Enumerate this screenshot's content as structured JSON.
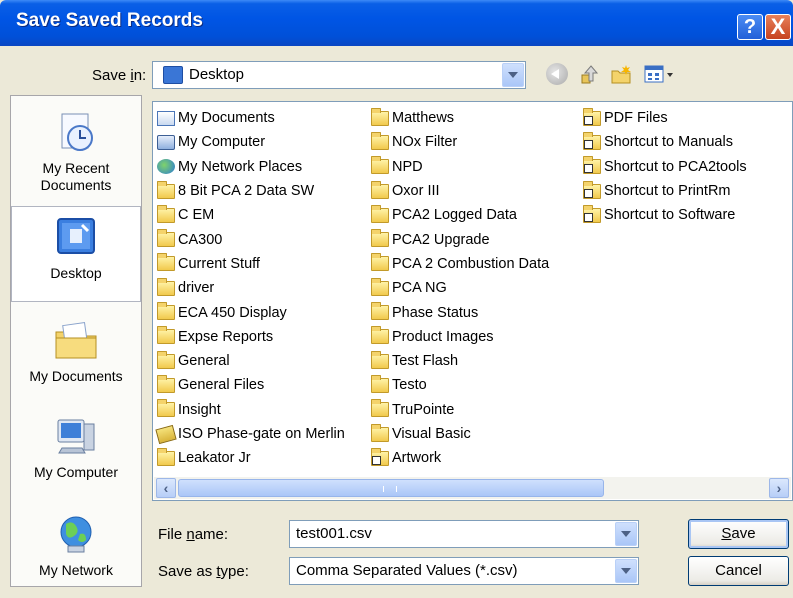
{
  "window": {
    "title": "Save Saved Records"
  },
  "titlebar": {
    "help_glyph": "?",
    "close_glyph": "X"
  },
  "save_in": {
    "label_pre": "Save ",
    "label_accel": "i",
    "label_post": "n:",
    "value": "Desktop"
  },
  "places": [
    {
      "label": "My Recent Documents",
      "icon": "recent-documents-icon"
    },
    {
      "label": "Desktop",
      "icon": "desktop-icon",
      "selected": true
    },
    {
      "label": "My Documents",
      "icon": "my-documents-icon"
    },
    {
      "label": "My Computer",
      "icon": "my-computer-icon"
    },
    {
      "label": "My Network",
      "icon": "my-network-icon"
    }
  ],
  "files": {
    "col1": [
      {
        "name": "My Documents",
        "type": "docs"
      },
      {
        "name": "My Computer",
        "type": "computer"
      },
      {
        "name": "My Network Places",
        "type": "network"
      },
      {
        "name": "8 Bit PCA 2 Data SW",
        "type": "folder"
      },
      {
        "name": "C EM",
        "type": "folder"
      },
      {
        "name": "CA300",
        "type": "folder"
      },
      {
        "name": "Current Stuff",
        "type": "folder"
      },
      {
        "name": "driver",
        "type": "folder"
      },
      {
        "name": "ECA 450 Display",
        "type": "folder"
      },
      {
        "name": "Expse Reports",
        "type": "folder"
      },
      {
        "name": "General",
        "type": "folder"
      },
      {
        "name": "General Files",
        "type": "folder"
      },
      {
        "name": "Insight",
        "type": "folder"
      },
      {
        "name": "ISO Phase-gate on Merlin",
        "type": "shortcut-link"
      },
      {
        "name": "Leakator Jr",
        "type": "folder"
      }
    ],
    "col2": [
      {
        "name": "Matthews",
        "type": "folder"
      },
      {
        "name": "NOx Filter",
        "type": "folder"
      },
      {
        "name": "NPD",
        "type": "folder"
      },
      {
        "name": "Oxor III",
        "type": "folder"
      },
      {
        "name": "PCA2 Logged Data",
        "type": "folder"
      },
      {
        "name": "PCA2 Upgrade",
        "type": "folder"
      },
      {
        "name": "PCA 2 Combustion Data",
        "type": "folder"
      },
      {
        "name": "PCA NG",
        "type": "folder"
      },
      {
        "name": "Phase Status",
        "type": "folder"
      },
      {
        "name": "Product Images",
        "type": "folder"
      },
      {
        "name": "Test Flash",
        "type": "folder"
      },
      {
        "name": "Testo",
        "type": "folder"
      },
      {
        "name": "TruPointe",
        "type": "folder"
      },
      {
        "name": "Visual Basic",
        "type": "folder"
      },
      {
        "name": "Artwork",
        "type": "folder-shortcut"
      }
    ],
    "col3": [
      {
        "name": "PDF Files",
        "type": "folder-shortcut"
      },
      {
        "name": "Shortcut to Manuals",
        "type": "folder-shortcut"
      },
      {
        "name": "Shortcut to PCA2tools",
        "type": "folder-shortcut"
      },
      {
        "name": "Shortcut to PrintRm",
        "type": "folder-shortcut"
      },
      {
        "name": "Shortcut to Software",
        "type": "folder-shortcut"
      }
    ]
  },
  "file_name": {
    "label_pre": "File ",
    "label_accel": "n",
    "label_post": "ame:",
    "value": "test001.csv"
  },
  "save_as_type": {
    "label_pre": "Save as ",
    "label_accel": "t",
    "label_post": "ype:",
    "value": "Comma Separated Values (*.csv)"
  },
  "buttons": {
    "save_accel": "S",
    "save_rest": "ave",
    "cancel": "Cancel"
  },
  "colors": {
    "titlebar": "#0055e5",
    "dialog_bg": "#ece9d8",
    "border": "#7f9db9"
  }
}
